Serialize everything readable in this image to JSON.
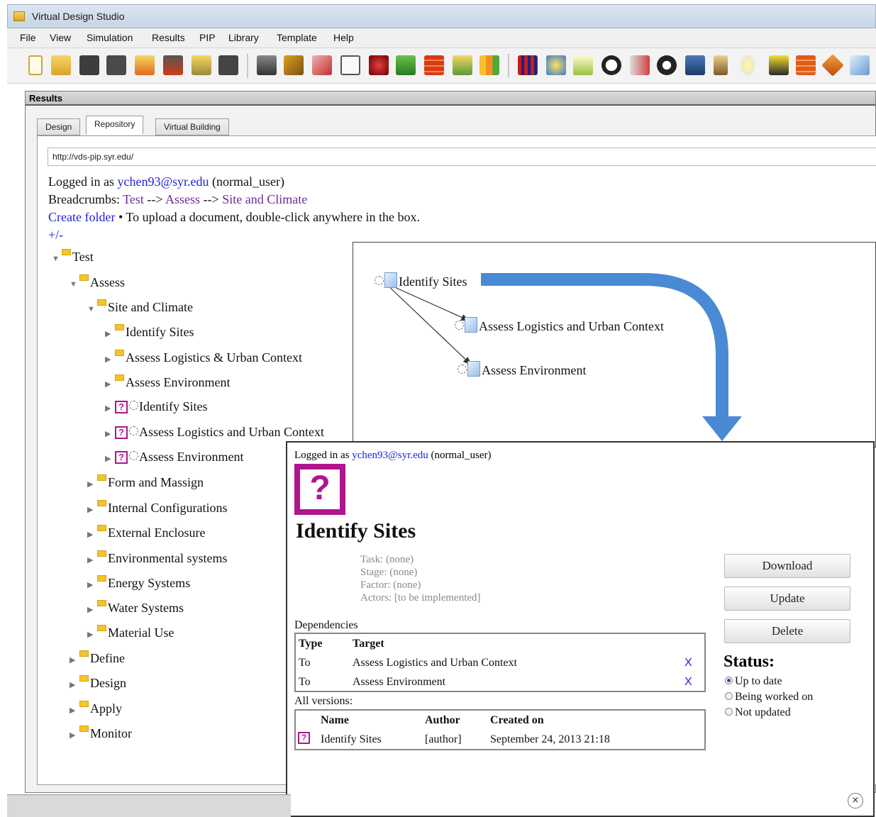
{
  "window": {
    "title": "Virtual Design Studio"
  },
  "menu": [
    "File",
    "View",
    "Simulation",
    "Results",
    "PIP",
    "Library",
    "Template",
    "Help"
  ],
  "toolbar_icons": [
    "new-file-icon",
    "open-icon",
    "save-icon",
    "save-as-icon",
    "import-idf-icon",
    "save-idf-icon",
    "import-lib-icon",
    "save-lib-icon",
    "vds-icon",
    "wrench-icon",
    "pencil-icon",
    "copy-doc-icon",
    "energyplus-icon",
    "wb-icon",
    "wall-icon",
    "csv-icon",
    "chart-icon",
    "books-icon",
    "sun-icon",
    "ground-icon",
    "skull-icon",
    "thermometer-icon",
    "building-icon",
    "monitor-icon",
    "person-icon",
    "lightbulb-icon",
    "shield-icon",
    "brick-icon",
    "eraser-icon",
    "window-icon"
  ],
  "panel": {
    "title": "Results"
  },
  "tabs": [
    "Design",
    "Repository",
    "Virtual Building"
  ],
  "repo": {
    "url": "http://vds-pip.syr.edu/",
    "logged_prefix": "Logged in as",
    "user": "ychen93@syr.edu",
    "role": "(normal_user)",
    "breadcrumbs_label": "Breadcrumbs:",
    "breadcrumbs": [
      "Test",
      "Assess",
      "Site and Climate"
    ],
    "breadcrumb_sep": "-->",
    "create_folder": "Create folder",
    "upload_hint": "• To upload a document, double-click anywhere in the box.",
    "toggle": "+/-"
  },
  "tree": {
    "root": "Test",
    "assess": "Assess",
    "site": "Site and Climate",
    "site_children": [
      "Identify Sites",
      "Assess Logistics & Urban Context",
      "Assess Environment"
    ],
    "site_docs": [
      "Identify Sites",
      "Assess Logistics and Urban Context",
      "Assess Environment"
    ],
    "assess_children": [
      "Form and Massign",
      "Internal Configurations",
      "External Enclosure",
      "Environmental systems",
      "Energy Systems",
      "Water Systems",
      "Material Use"
    ],
    "root_children": [
      "Define",
      "Design",
      "Apply",
      "Monitor"
    ]
  },
  "graph": {
    "source": "Identify Sites",
    "targets": [
      "Assess Logistics and Urban Context",
      "Assess Environment"
    ]
  },
  "detail": {
    "logged_prefix": "Logged in as",
    "user": "ychen93@syr.edu",
    "role": "(normal_user)",
    "icon_glyph": "?",
    "title": "Identify Sites",
    "task": "Task: (none)",
    "stage": "Stage: (none)",
    "factor": "Factor: (none)",
    "actors": "Actors: [to be implemented]",
    "buttons": {
      "download": "Download",
      "update": "Update",
      "delete": "Delete"
    },
    "dependencies_label": "Dependencies",
    "dep_headers": {
      "type": "Type",
      "target": "Target"
    },
    "dependencies": [
      {
        "type": "To",
        "target": "Assess Logistics and Urban Context",
        "remove": "X"
      },
      {
        "type": "To",
        "target": "Assess Environment",
        "remove": "X"
      }
    ],
    "versions_label": "All versions:",
    "ver_headers": {
      "name": "Name",
      "author": "Author",
      "created": "Created on"
    },
    "versions": [
      {
        "name": "Identify Sites",
        "author": "[author]",
        "created": "September 24, 2013 21:18"
      }
    ],
    "status_label": "Status:",
    "status_options": [
      "Up to date",
      "Being worked on",
      "Not updated"
    ],
    "status_selected": "Up to date",
    "close_glyph": "×"
  },
  "colors": {
    "accent_magenta": "#b0158c",
    "link_blue": "#1f1fe0",
    "visited_purple": "#6b2a9a",
    "arrow_blue": "#4a8ad4",
    "folder_yellow": "#f4c52b"
  }
}
